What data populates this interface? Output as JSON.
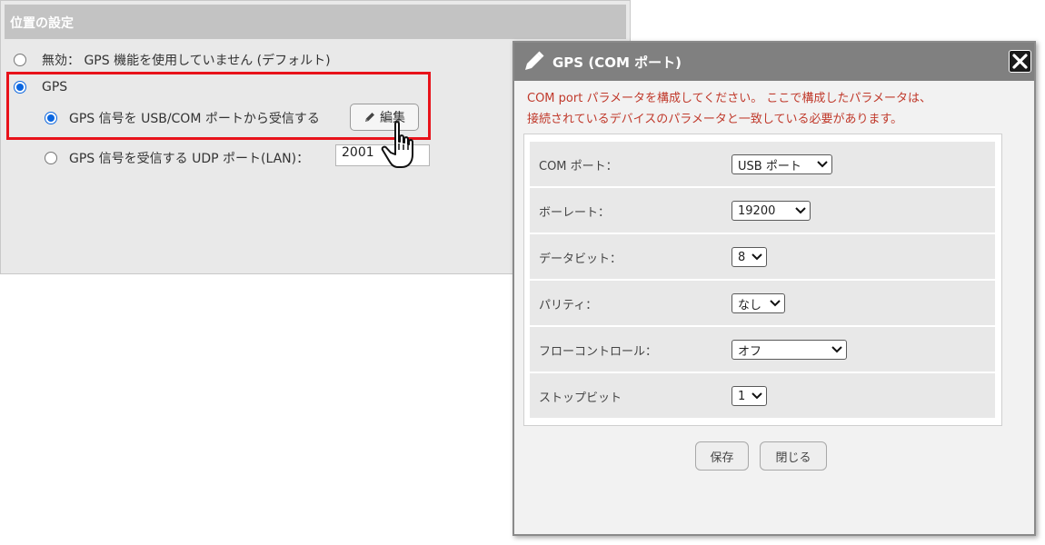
{
  "settings": {
    "header": "位置の設定",
    "options": {
      "disabled_label": "無効： GPS 機能を使用していません (デフォルト)",
      "gps_label": "GPS",
      "usb_com_label": "GPS 信号を USB/COM ポートから受信する",
      "udp_label": "GPS 信号を受信する UDP ポート(LAN)："
    },
    "edit_button_label": "編集",
    "udp_port_value": "2001",
    "selected_option": "gps-usb-com"
  },
  "modal": {
    "title": "GPS (COM ポート)",
    "description_line1": "COM port パラメータを構成してください。 ここで構成したパラメータは、",
    "description_line2": "接続されているデバイスのパラメータと一致している必要があります。",
    "fields": {
      "com_port": {
        "label": "COM ポート：",
        "value": "USB ポート"
      },
      "baud_rate": {
        "label": "ボーレート：",
        "value": "19200"
      },
      "data_bits": {
        "label": "データビット：",
        "value": "8"
      },
      "parity": {
        "label": "パリティ：",
        "value": "なし"
      },
      "flow_control": {
        "label": "フローコントロール：",
        "value": "オフ"
      },
      "stop_bits": {
        "label": "ストップビット",
        "value": "1"
      }
    },
    "save_label": "保存",
    "close_label": "閉じる"
  },
  "colors": {
    "accent_radio": "#0a66e0",
    "highlight_border": "#e8121a",
    "description_text": "#c0392b",
    "modal_titlebar": "#808080"
  },
  "icons": [
    "pencil-icon",
    "hand-pointer-cursor-icon",
    "close-icon",
    "chevron-down-icon"
  ]
}
